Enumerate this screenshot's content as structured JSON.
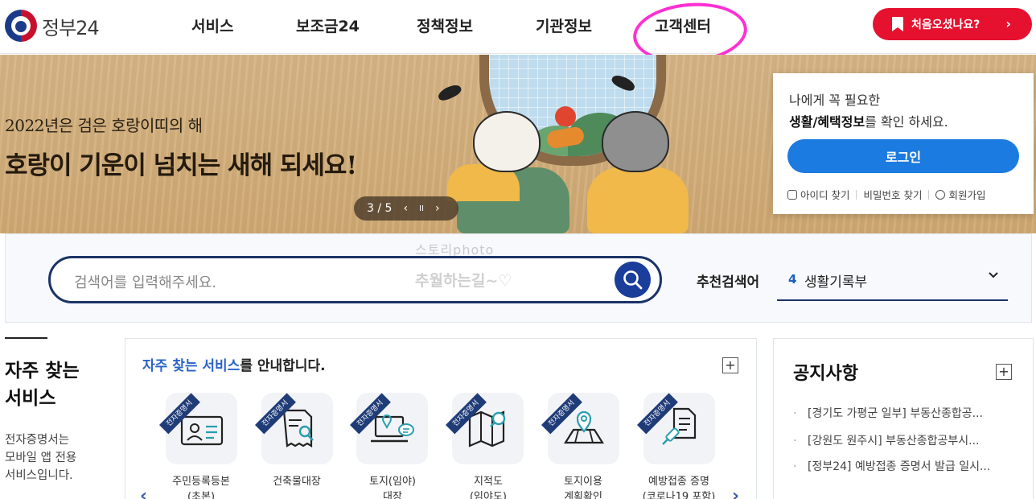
{
  "header": {
    "logo_text": "정부24",
    "nav": [
      "서비스",
      "보조금24",
      "정책정보",
      "기관정보",
      "고객센터"
    ],
    "cta_label": "처음오셨나요?",
    "cta_arrow": "›",
    "colors": {
      "cta": "#e6112f",
      "highlight": "#ff2fd2"
    }
  },
  "banner": {
    "subtitle": "2022년은 검은 호랑이띠의 해",
    "title": "호랑이 기운이 넘치는 새해 되세요!",
    "slide_counter": "3 / 5",
    "prev": "‹",
    "pause": "II",
    "next": "›"
  },
  "login": {
    "line1": "나에게 꼭 필요한",
    "line2_bold": "생활/혜택정보",
    "line2_rest": "를 확인 하세요.",
    "button": "로그인",
    "links": [
      "아이디 찾기",
      "비밀번호 찾기",
      "회원가입"
    ],
    "accent": "#1c7be0"
  },
  "search": {
    "placeholder": "검색어를 입력해주세요.",
    "watermark_top": "스토리photo",
    "watermark_mid": "추월하는길~♡",
    "recommend_label": "추천검색어",
    "recommend_rank": "4",
    "recommend_value": "생활기록부"
  },
  "frequent": {
    "title_line1": "자주 찾는",
    "title_line2": "서비스",
    "desc_lines": [
      "전자증명서는",
      "모바일 앱 전용",
      "서비스입니다."
    ],
    "heading_highlight": "자주 찾는 서비스",
    "heading_rest": "를 안내합니다.",
    "tag": "전자증명서",
    "services": [
      {
        "label1": "주민등록등본",
        "label2": "(초본)",
        "icon": "id-card-icon"
      },
      {
        "label1": "건축물대장",
        "label2": "",
        "icon": "document-search-icon"
      },
      {
        "label1": "토지(임야)",
        "label2": "대장",
        "icon": "laptop-location-icon"
      },
      {
        "label1": "지적도",
        "label2": "(임야도)",
        "icon": "map-search-icon"
      },
      {
        "label1": "토지이용",
        "label2": "계획확인",
        "icon": "map-pin-icon"
      },
      {
        "label1": "예방접종 증명",
        "label2": "(코로나19 포함)",
        "icon": "vaccine-icon"
      }
    ],
    "prev": "‹",
    "next": "›",
    "plus": "+"
  },
  "notices": {
    "title": "공지사항",
    "plus": "+",
    "items": [
      "[경기도 가평군 일부] 부동산종합공...",
      "[강원도 원주시] 부동산종합공부시...",
      "[정부24] 예방접종 증명서 발급 일시..."
    ]
  }
}
